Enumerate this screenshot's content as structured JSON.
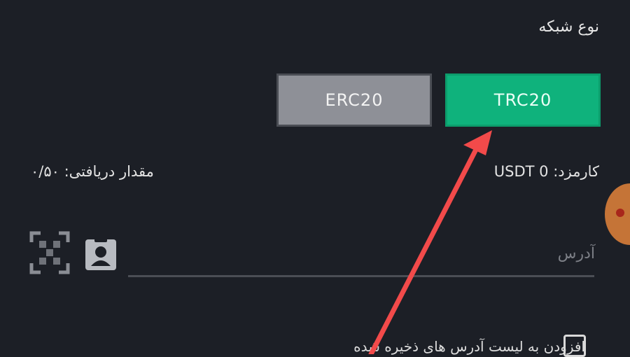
{
  "network": {
    "label": "نوع شبکه",
    "options": [
      {
        "label": "ERC20",
        "selected": false
      },
      {
        "label": "TRC20",
        "selected": true
      }
    ]
  },
  "fee": {
    "text": "کارمزد: 0 USDT"
  },
  "receive": {
    "text": "مقدار دریافتی: ۰/۵۰"
  },
  "address": {
    "placeholder": "آدرس"
  },
  "icons": {
    "qr": "qr-scan-icon",
    "contact": "contact-card-icon"
  },
  "save_address": {
    "label": "افزودن به لیست آدرس های ذخیره شده"
  },
  "colors": {
    "background": "#1c1f26",
    "selected": "#0fb27c",
    "unselected": "#8e9097",
    "annotation_arrow": "#f24a4a"
  }
}
